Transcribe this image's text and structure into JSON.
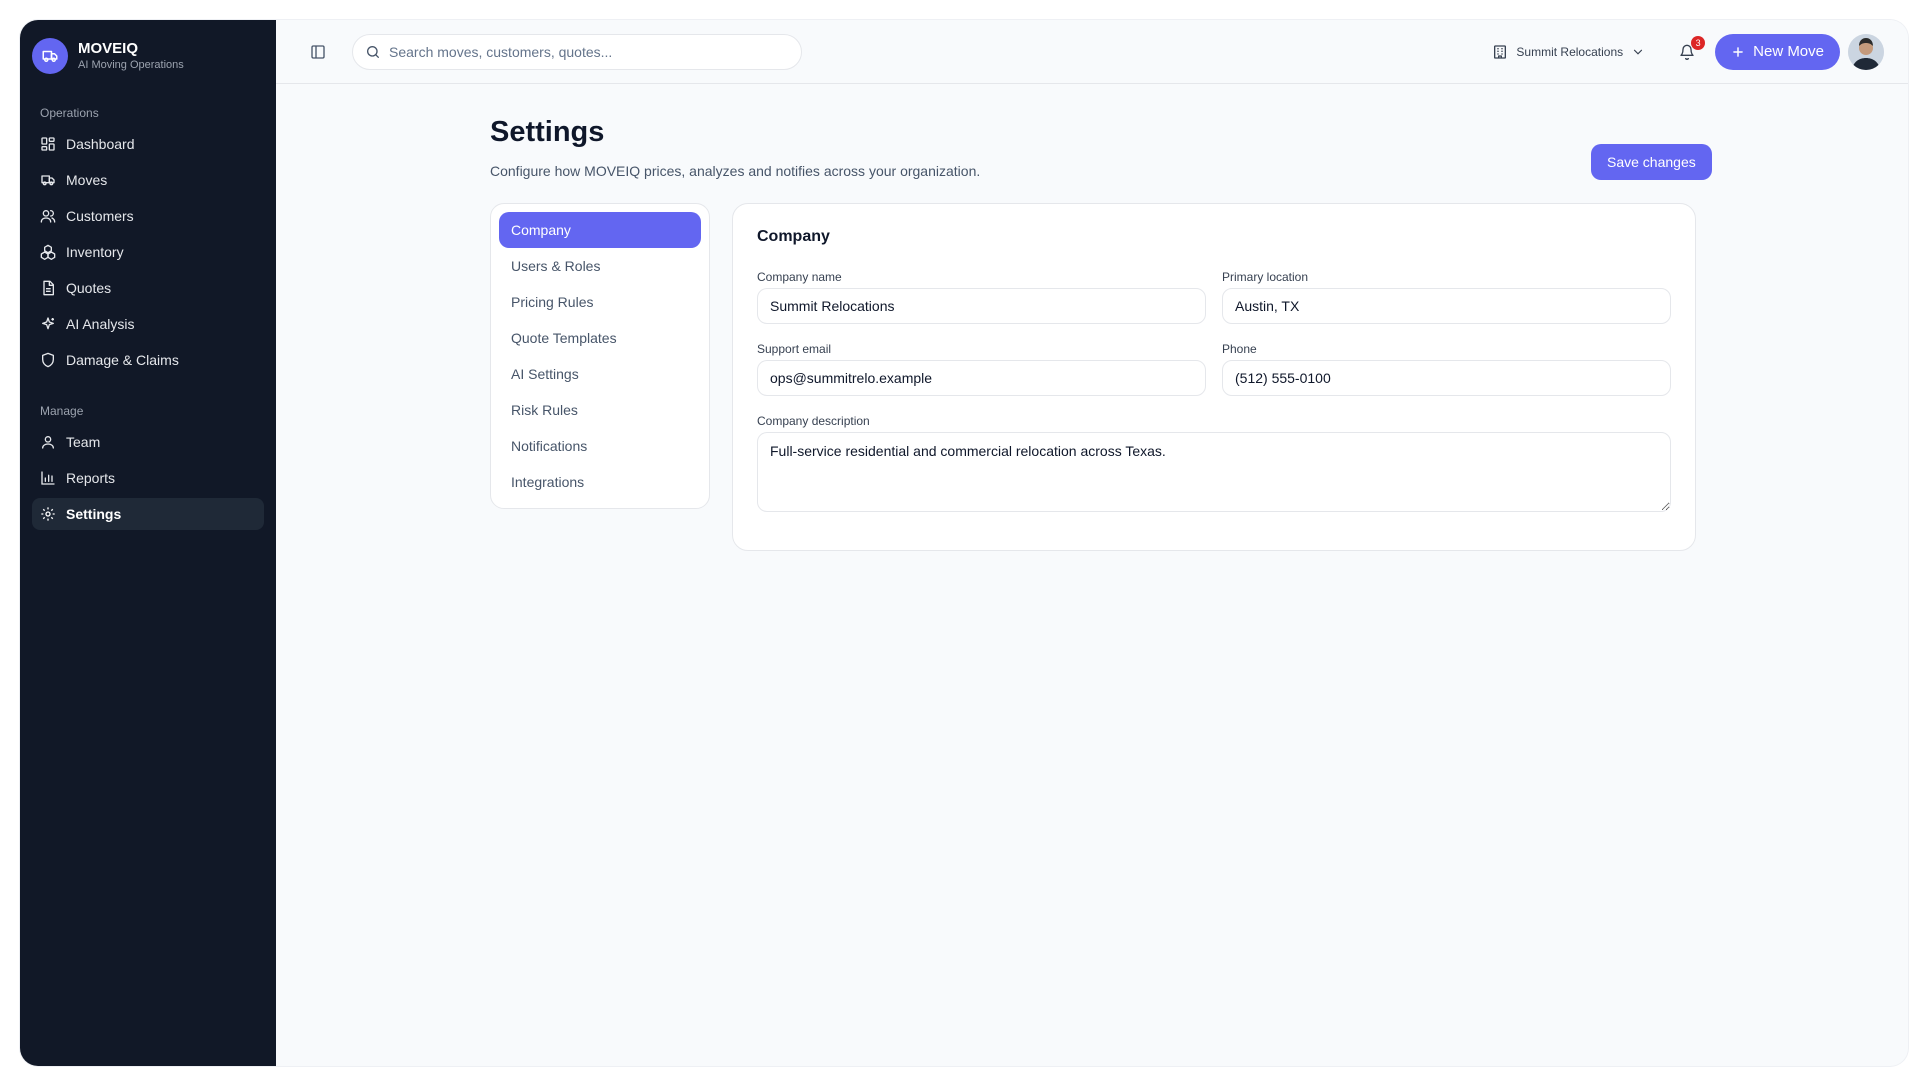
{
  "brand": {
    "name": "MOVEIQ",
    "tagline": "AI Moving Operations"
  },
  "sidebar": {
    "operations_label": "Operations",
    "operations": [
      {
        "label": "Dashboard",
        "icon": "dashboard-icon"
      },
      {
        "label": "Moves",
        "icon": "truck-icon"
      },
      {
        "label": "Customers",
        "icon": "users-icon"
      },
      {
        "label": "Inventory",
        "icon": "boxes-icon"
      },
      {
        "label": "Quotes",
        "icon": "document-icon"
      },
      {
        "label": "AI Analysis",
        "icon": "sparkles-icon"
      },
      {
        "label": "Damage & Claims",
        "icon": "shield-icon"
      }
    ],
    "manage_label": "Manage",
    "manage": [
      {
        "label": "Team",
        "icon": "user-icon"
      },
      {
        "label": "Reports",
        "icon": "bar-chart-icon"
      },
      {
        "label": "Settings",
        "icon": "gear-icon",
        "active": true
      }
    ]
  },
  "topbar": {
    "search_placeholder": "Search moves, customers, quotes...",
    "org": "Summit Relocations",
    "notifications_count": "3",
    "new_move_label": "New Move"
  },
  "page": {
    "title": "Settings",
    "subtitle": "Configure how MOVEIQ prices, analyzes and notifies across your organization.",
    "save_label": "Save changes"
  },
  "settings_nav": [
    {
      "label": "Company",
      "active": true
    },
    {
      "label": "Users & Roles"
    },
    {
      "label": "Pricing Rules"
    },
    {
      "label": "Quote Templates"
    },
    {
      "label": "AI Settings"
    },
    {
      "label": "Risk Rules"
    },
    {
      "label": "Notifications"
    },
    {
      "label": "Integrations"
    }
  ],
  "company": {
    "title": "Company",
    "name_label": "Company name",
    "name_value": "Summit Relocations",
    "location_label": "Primary location",
    "location_value": "Austin, TX",
    "email_label": "Support email",
    "email_value": "ops@summitrelo.example",
    "phone_label": "Phone",
    "phone_value": "(512) 555-0100",
    "description_label": "Company description",
    "description_value": "Full-service residential and commercial relocation across Texas."
  },
  "colors": {
    "accent": "#6366f1",
    "sidebar_bg": "#111827",
    "badge": "#dc2626"
  }
}
